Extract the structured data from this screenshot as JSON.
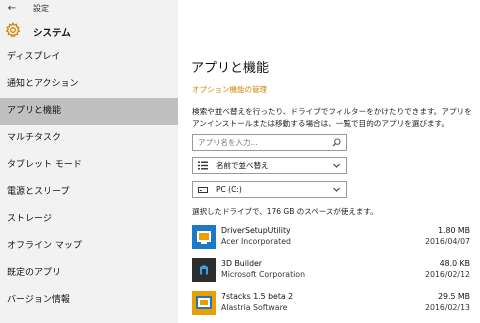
{
  "window": {
    "title": "設定",
    "back_glyph": "←"
  },
  "app": {
    "name": "システム",
    "accent": "#d08600"
  },
  "sidebar": {
    "items": [
      {
        "label": "ディスプレイ",
        "active": false
      },
      {
        "label": "通知とアクション",
        "active": false
      },
      {
        "label": "アプリと機能",
        "active": true
      },
      {
        "label": "マルチタスク",
        "active": false
      },
      {
        "label": "タブレット モード",
        "active": false
      },
      {
        "label": "電源とスリープ",
        "active": false
      },
      {
        "label": "ストレージ",
        "active": false
      },
      {
        "label": "オフライン マップ",
        "active": false
      },
      {
        "label": "既定のアプリ",
        "active": false
      },
      {
        "label": "バージョン情報",
        "active": false
      }
    ]
  },
  "main": {
    "title": "アプリと機能",
    "optional_link": "オプション機能の管理",
    "description": "検索や並べ替えを行ったり、ドライブでフィルターをかけたりできます。アプリをアンインストールまたは移動する場合は、一覧で目的のアプリを選びます。",
    "search": {
      "placeholder": "アプリ名を入力...",
      "icon": "search-icon"
    },
    "sort": {
      "value": "名前で並べ替え",
      "icon": "sort-list-icon"
    },
    "drive": {
      "value": "PC (C:)",
      "icon": "drive-icon"
    },
    "space_info": "選択したドライブで、176 GB のスペースが使えます。",
    "apps": [
      {
        "name": "DriverSetupUtility",
        "publisher": "Acer Incorporated",
        "size": "1.80 MB",
        "date": "2016/04/07",
        "icon": "driver-setup-icon",
        "tile_color": "#1e78c8"
      },
      {
        "name": "3D Builder",
        "publisher": "Microsoft Corporation",
        "size": "48.0 KB",
        "date": "2016/02/12",
        "icon": "3d-builder-icon",
        "tile_color": "#2d2d2d"
      },
      {
        "name": "7stacks 1.5 beta 2",
        "publisher": "Alastria Software",
        "size": "29.5 MB",
        "date": "2016/02/13",
        "icon": "7stacks-icon",
        "tile_color": "#e8a000"
      }
    ]
  }
}
